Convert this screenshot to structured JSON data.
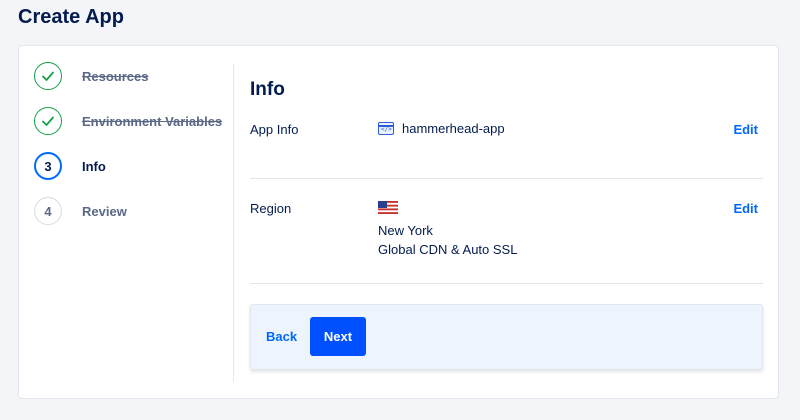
{
  "page": {
    "title": "Create App"
  },
  "stepper": {
    "steps": [
      {
        "number": "",
        "label": "Resources",
        "state": "done",
        "icon": "check-icon"
      },
      {
        "number": "",
        "label": "Environment Variables",
        "state": "done",
        "icon": "check-icon"
      },
      {
        "number": "3",
        "label": "Info",
        "state": "active"
      },
      {
        "number": "4",
        "label": "Review",
        "state": "pending"
      }
    ]
  },
  "info": {
    "title": "Info",
    "app_info": {
      "label": "App Info",
      "app_name": "hammerhead-app",
      "icon": "app-window-icon",
      "edit_label": "Edit"
    },
    "region": {
      "label": "Region",
      "flag": "us-flag-icon",
      "city": "New York",
      "features": "Global CDN & Auto SSL",
      "edit_label": "Edit"
    }
  },
  "footer": {
    "back_label": "Back",
    "next_label": "Next"
  },
  "colors": {
    "accent": "#0069ff",
    "primary_button": "#0050ff",
    "success": "#15a34a",
    "text": "#031b4e"
  }
}
